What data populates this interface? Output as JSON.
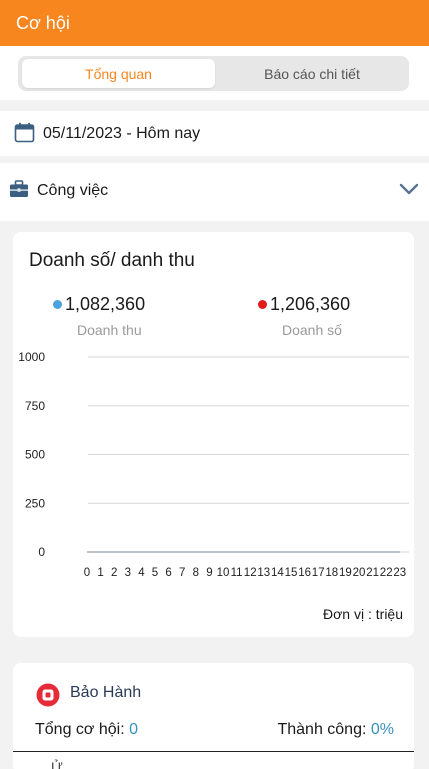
{
  "header": {
    "title": "Cơ hội"
  },
  "tabs": {
    "overview": "Tổng quan",
    "report": "Báo cáo chi tiết",
    "active": "overview"
  },
  "filter": {
    "date_range": "05/11/2023 - Hôm nay",
    "category": "Công việc"
  },
  "colors": {
    "brand": "#f7861f",
    "revenue": "#4aa3df",
    "sales": "#e11a1a",
    "value": "#3a8fc1"
  },
  "icons": {
    "date": "calendar-icon",
    "category": "briefcase-icon",
    "expand": "chevron-down-icon",
    "warranty": "warranty-icon"
  },
  "chart": {
    "title": "Doanh số/ danh thu",
    "unit": "Đơn vị : triệu",
    "legend": [
      {
        "value": "1,082,360",
        "label": "Doanh thu"
      },
      {
        "value": "1,206,360",
        "label": "Doanh số"
      }
    ]
  },
  "chart_data": {
    "type": "line",
    "title": "Doanh số/ danh thu",
    "x": [
      0,
      1,
      2,
      3,
      4,
      5,
      6,
      7,
      8,
      9,
      10,
      11,
      12,
      13,
      14,
      15,
      16,
      17,
      18,
      19,
      20,
      21,
      22,
      23
    ],
    "ylim": [
      0,
      1000
    ],
    "yticks": [
      0,
      250,
      500,
      750,
      1000
    ],
    "grid": true,
    "series": [
      {
        "name": "Doanh thu",
        "values": [
          0,
          0,
          0,
          0,
          0,
          0,
          0,
          0,
          0,
          0,
          0,
          0,
          0,
          0,
          0,
          0,
          0,
          0,
          0,
          0,
          0,
          0,
          0,
          0
        ]
      },
      {
        "name": "Doanh số",
        "values": [
          0,
          0,
          0,
          0,
          0,
          0,
          0,
          0,
          0,
          0,
          0,
          0,
          0,
          0,
          0,
          0,
          0,
          0,
          0,
          0,
          0,
          0,
          0,
          0
        ]
      }
    ]
  },
  "warranty": {
    "name": "Bảo Hành",
    "total_label": "Tổng cơ hội: ",
    "total_value": "0",
    "success_label": "Thành công: ",
    "success_value": "0%",
    "next_partial": "Ử"
  }
}
